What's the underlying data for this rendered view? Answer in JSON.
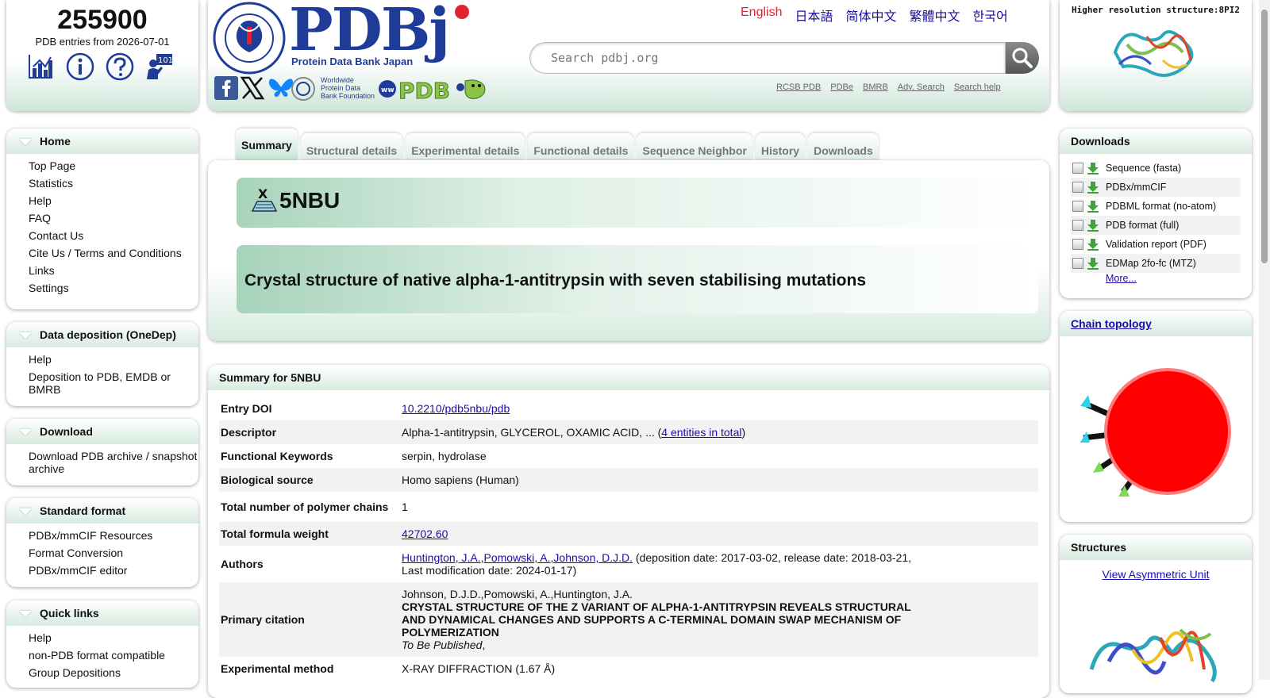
{
  "stats": {
    "entry_count": "255900",
    "entries_from": "PDB entries from 2026-07-01"
  },
  "header": {
    "logo_name": "PDBj",
    "logo_subtitle": "Protein Data Bank Japan",
    "wwpdb_foundation": "Worldwide Protein Data Bank Foundation",
    "languages": [
      "English",
      "日本語",
      "简体中文",
      "繁體中文",
      "한국어"
    ],
    "active_language": "English",
    "search_placeholder": "Search pdbj.org",
    "links": [
      "RCSB PDB",
      "PDBe",
      "BMRB",
      "Adv. Search",
      "Search help"
    ]
  },
  "hires": {
    "title": "Higher resolution structure:8PI2"
  },
  "left_menu": [
    {
      "title": "Home",
      "items": [
        "Top Page",
        "Statistics",
        "Help",
        "FAQ",
        "Contact Us",
        "Cite Us / Terms and Conditions",
        "Links",
        "Settings"
      ]
    },
    {
      "title": "Data deposition (OneDep)",
      "items": [
        "Help",
        "Deposition to PDB, EMDB or BMRB"
      ]
    },
    {
      "title": "Download",
      "items": [
        "Download PDB archive / snapshot archive"
      ]
    },
    {
      "title": "Standard format",
      "items": [
        "PDBx/mmCIF Resources",
        "Format Conversion",
        "PDBx/mmCIF editor"
      ]
    },
    {
      "title": "Quick links",
      "items": [
        "Help",
        "non-PDB format compatible",
        "Group Depositions"
      ]
    }
  ],
  "tabs": [
    "Summary",
    "Structural details",
    "Experimental details",
    "Functional details",
    "Sequence Neighbor",
    "History",
    "Downloads"
  ],
  "active_tab": "Summary",
  "entry": {
    "id": "5NBU",
    "title": "Crystal structure of native alpha-1-antitrypsin with seven stabilising mutations"
  },
  "summary": {
    "header": "Summary for 5NBU",
    "rows": {
      "doi_label": "Entry DOI",
      "doi_value": "10.2210/pdb5nbu/pdb",
      "descriptor_label": "Descriptor",
      "descriptor_value": "Alpha-1-antitrypsin, GLYCEROL, OXAMIC ACID, ... (",
      "descriptor_link": "4 entities in total",
      "descriptor_close": ")",
      "keywords_label": "Functional Keywords",
      "keywords_value": "serpin, hydrolase",
      "source_label": "Biological source",
      "source_value": "Homo sapiens (Human)",
      "chains_label": "Total number of polymer chains",
      "chains_value": "1",
      "weight_label": "Total formula weight",
      "weight_value": "42702.60",
      "authors_label": "Authors",
      "authors_link": "Huntington, J.A.,Pomowski, A.,Johnson, D.J.D.",
      "authors_dates": "(deposition date: 2017-03-02, release date: 2018-03-21, Last modification date: 2024-01-17)",
      "citation_label": "Primary citation",
      "citation_authors": "Johnson, D.J.D.,Pomowski, A.,Huntington, J.A.",
      "citation_title": "CRYSTAL STRUCTURE OF THE Z VARIANT OF ALPHA-1-ANTITRYPSIN REVEALS STRUCTURAL AND DYNAMICAL CHANGES AND SUPPORTS A C-TERMINAL DOMAIN SWAP MECHANISM OF POLYMERIZATION",
      "citation_journal": "To Be Published",
      "citation_sep": ",",
      "method_label": "Experimental method",
      "method_value": "X-RAY DIFFRACTION (1.67 Å)"
    }
  },
  "downloads": {
    "title": "Downloads",
    "items": [
      "Sequence (fasta)",
      "PDBx/mmCIF",
      "PDBML format (no-atom)",
      "PDB format (full)",
      "Validation report (PDF)",
      "EDMap 2fo-fc (MTZ)"
    ],
    "more": "More..."
  },
  "chain_topology": {
    "title": "Chain topology"
  },
  "structures": {
    "title": "Structures",
    "link": "View Asymmetric Unit"
  },
  "colors": {
    "accent_green": "#a7d3bb",
    "link": "#1a0dab",
    "active_lang": "#e0242f",
    "logo_blue": "#1f3c99",
    "topology_red": "#ff0000"
  }
}
